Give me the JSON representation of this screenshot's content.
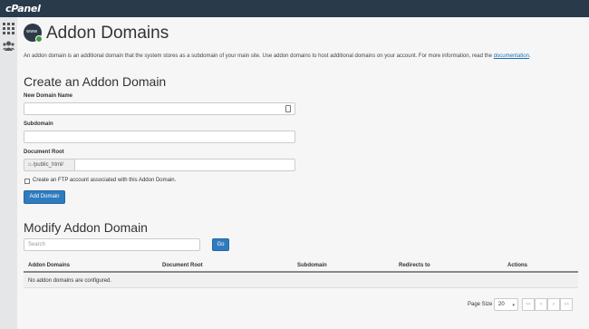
{
  "header": {
    "logo": "cPanel"
  },
  "sidebar": {
    "icons": [
      "grid-icon",
      "users-icon"
    ]
  },
  "page": {
    "title": "Addon Domains",
    "icon_text": "www",
    "description": "An addon domain is an additional domain that the system stores as a subdomain of your main site. Use addon domains to host additional domains on your account. For more information, read the ",
    "description_link": "documentation",
    "description_end": "."
  },
  "create": {
    "heading": "Create an Addon Domain",
    "new_domain_label": "New Domain Name",
    "new_domain_value": "",
    "subdomain_label": "Subdomain",
    "subdomain_value": "",
    "docroot_label": "Document Root",
    "docroot_prefix": "/public_html/",
    "docroot_value": "",
    "ftp_checkbox_label": "Create an FTP account associated with this Addon Domain.",
    "submit_label": "Add Domain"
  },
  "modify": {
    "heading": "Modify Addon Domain",
    "search_placeholder": "Search",
    "go_label": "Go",
    "columns": [
      "Addon Domains",
      "Document Root",
      "Subdomain",
      "Redirects to",
      "Actions"
    ],
    "empty_message": "No addon domains are configured."
  },
  "pagination": {
    "page_size_label": "Page Size",
    "page_size_value": "20",
    "buttons": [
      "<<",
      "<",
      ">",
      ">>"
    ]
  },
  "colors": {
    "topbar": "#293a4a",
    "primary": "#2f7bbf",
    "link": "#1a6fb5"
  }
}
